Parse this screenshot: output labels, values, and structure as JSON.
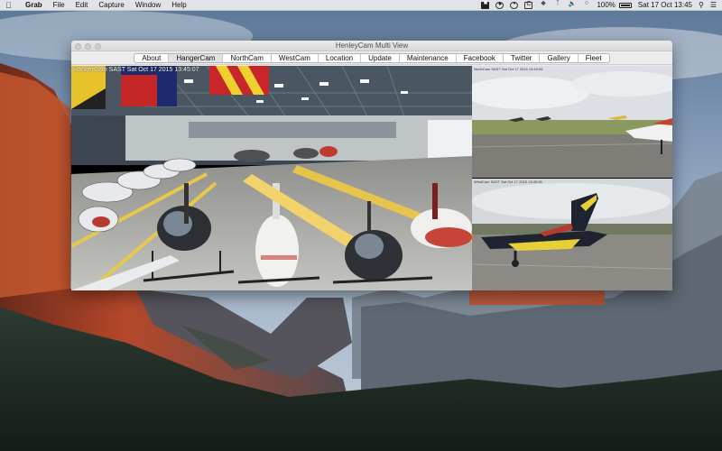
{
  "menubar": {
    "app_name": "Grab",
    "menus": [
      "File",
      "Edit",
      "Capture",
      "Window",
      "Help"
    ],
    "status_icons": [
      "dark-square-icon",
      "record-icon",
      "circle-icon",
      "c-icon",
      "dropbox-icon",
      "bluetooth-icon",
      "volume-icon",
      "wifi-icon"
    ],
    "battery": "100%",
    "clock": "Sat 17 Oct  13:45"
  },
  "window": {
    "title": "HenleyCam Multi View",
    "tabs": [
      {
        "label": "About",
        "selected": false
      },
      {
        "label": "HangerCam",
        "selected": true
      },
      {
        "label": "NorthCam",
        "selected": false
      },
      {
        "label": "WestCam",
        "selected": false
      },
      {
        "label": "Location",
        "selected": false
      },
      {
        "label": "Update",
        "selected": false
      },
      {
        "label": "Maintenance",
        "selected": false
      },
      {
        "label": "Facebook",
        "selected": false
      },
      {
        "label": "Twitter",
        "selected": false
      },
      {
        "label": "Gallery",
        "selected": false
      },
      {
        "label": "Fleet",
        "selected": false
      }
    ]
  },
  "cameras": {
    "hangar": {
      "timestamp": "HangerCam SAST Sat Oct 17 2015 13:45:07"
    },
    "north": {
      "timestamp": "NorthCam SAST Sat Oct 17 2015 13:45:06"
    },
    "west": {
      "timestamp": "WestCam SAST Sat Oct 17 2015 13:45:06"
    }
  },
  "colors": {
    "menubar_bg": "#ececec",
    "window_bg": "#ececec",
    "hangar_floor": "#b7b8b4",
    "sky": "#dfe3e8"
  }
}
